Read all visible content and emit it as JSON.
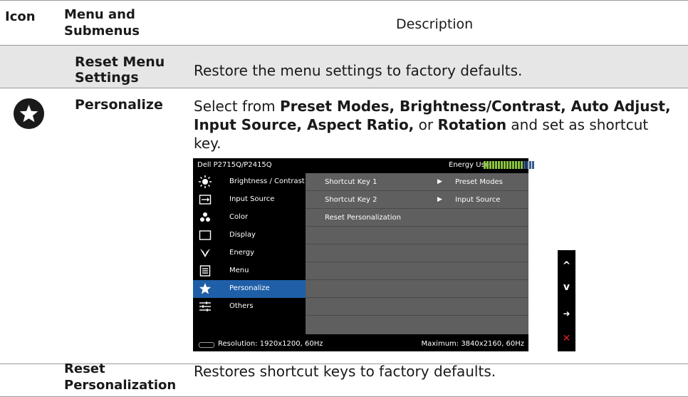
{
  "table": {
    "headers": {
      "icon": "Icon",
      "menu_line1": "Menu and",
      "menu_line2": "Submenus",
      "description": "Description"
    },
    "rows": [
      {
        "menu_line1": "Reset Menu",
        "menu_line2": "Settings",
        "description": "Restore the menu settings to factory defaults."
      },
      {
        "icon": "star-circle-icon",
        "menu": "Personalize",
        "description_parts": {
          "p1": "Select from ",
          "b1": "Preset Modes, Brightness/Contrast, Auto Adjust,",
          "b2": "Input Source, Aspect Ratio,",
          "p2": " or ",
          "b3": "Rotation",
          "p3": " and set as shortcut",
          "p4": "key."
        }
      },
      {
        "menu_line1": "Reset",
        "menu_line2": "Personalization",
        "description": "Restores shortcut keys to factory defaults."
      }
    ]
  },
  "osd": {
    "title": "Dell P2715Q/P2415Q",
    "energy_label": "Energy Use",
    "energy_level": 0.75,
    "menu_items": [
      {
        "label": "Brightness / Contrast",
        "icon": "brightness-icon"
      },
      {
        "label": "Input Source",
        "icon": "input-source-icon"
      },
      {
        "label": "Color",
        "icon": "color-dots-icon"
      },
      {
        "label": "Display",
        "icon": "display-icon"
      },
      {
        "label": "Energy",
        "icon": "energy-icon"
      },
      {
        "label": "Menu",
        "icon": "menu-icon"
      },
      {
        "label": "Personalize",
        "icon": "star-icon",
        "selected": true
      },
      {
        "label": "Others",
        "icon": "others-icon"
      }
    ],
    "rows": [
      {
        "key": "Shortcut Key 1",
        "value": "Preset Modes"
      },
      {
        "key": "Shortcut Key 2",
        "value": "Input Source"
      },
      {
        "key": "Reset Personalization",
        "value": ""
      }
    ],
    "arrow_glyph": "▶",
    "footer": {
      "resolution": "Resolution: 1920x1200, 60Hz",
      "maximum": "Maximum: 3840x2160, 60Hz"
    },
    "buttons": [
      {
        "icon": "up-chevron-icon",
        "glyph": "^"
      },
      {
        "icon": "down-chevron-icon",
        "glyph": "v"
      },
      {
        "icon": "right-arrow-icon",
        "glyph": "➜"
      },
      {
        "icon": "close-x-icon",
        "glyph": "✕"
      }
    ],
    "colors": {
      "selected": "#1f5fa8",
      "panel": "#5f5f5f",
      "energy_on": "#8ac43f",
      "energy_off": "#3a5a8c",
      "exit": "#e11f26"
    }
  }
}
